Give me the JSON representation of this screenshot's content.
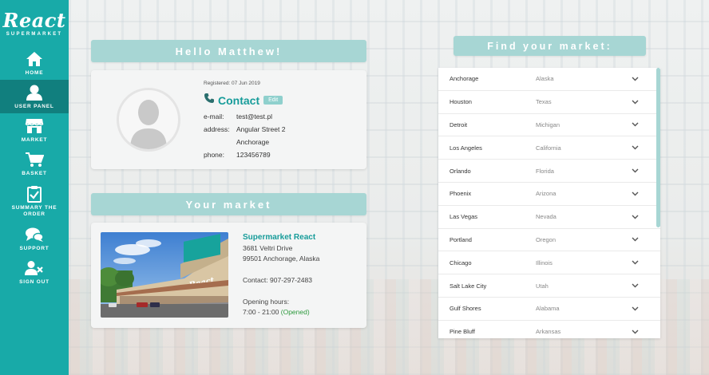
{
  "brand": {
    "name": "React",
    "subtitle": "SUPERMARKET"
  },
  "colors": {
    "accent": "#18aaa8",
    "active": "#117f7e",
    "banner": "#a7d6d4"
  },
  "nav": [
    {
      "label": "HOME",
      "icon": "home-icon"
    },
    {
      "label": "USER PANEL",
      "icon": "user-icon",
      "active": true
    },
    {
      "label": "MARKET",
      "icon": "store-icon"
    },
    {
      "label": "BASKET",
      "icon": "cart-icon"
    },
    {
      "label": "SUMMARY THE ORDER",
      "icon": "clipboard-check-icon"
    },
    {
      "label": "SUPPORT",
      "icon": "chat-icon"
    },
    {
      "label": "SIGN OUT",
      "icon": "user-remove-icon"
    }
  ],
  "greeting": "Hello Matthew!",
  "user": {
    "registered": "Registered: 07 Jun 2019",
    "contact_title": "Contact",
    "edit_label": "Edit",
    "email_label": "e-mail:",
    "email": "test@test.pl",
    "address_label": "address:",
    "address_line1": "Angular Street 2",
    "address_line2": "Anchorage",
    "phone_label": "phone:",
    "phone": "123456789"
  },
  "market_title": "Your market",
  "market": {
    "name": "Supermarket React",
    "street": "3681 Veltri Drive",
    "city": "99501 Anchorage, Alaska",
    "contact": "Contact: 907-297-2483",
    "hours_label": "Opening hours:",
    "hours": "7:00 - 21:00",
    "status": "(Opened)",
    "sign_text": "React"
  },
  "find_title": "Find your market:",
  "markets": [
    {
      "city": "Anchorage",
      "state": "Alaska"
    },
    {
      "city": "Houston",
      "state": "Texas"
    },
    {
      "city": "Detroit",
      "state": "Michigan"
    },
    {
      "city": "Los Angeles",
      "state": "California"
    },
    {
      "city": "Orlando",
      "state": "Florida"
    },
    {
      "city": "Phoenix",
      "state": "Arizona"
    },
    {
      "city": "Las Vegas",
      "state": "Nevada"
    },
    {
      "city": "Portland",
      "state": "Oregon"
    },
    {
      "city": "Chicago",
      "state": "Illinois"
    },
    {
      "city": "Salt Lake City",
      "state": "Utah"
    },
    {
      "city": "Gulf Shores",
      "state": "Alabama"
    },
    {
      "city": "Pine Bluff",
      "state": "Arkansas"
    }
  ]
}
